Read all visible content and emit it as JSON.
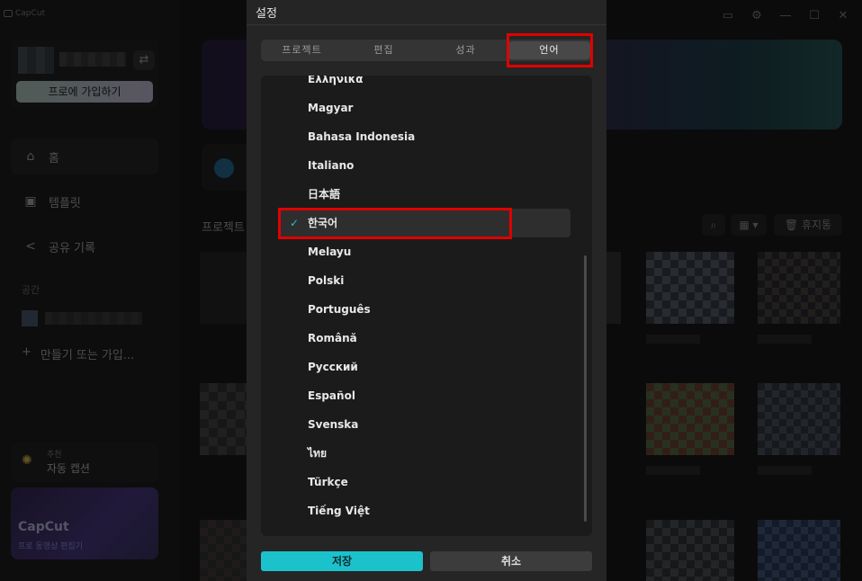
{
  "app": {
    "logo": "CapCut"
  },
  "sidebar": {
    "pro_button": "프로에 가입하기",
    "nav": [
      {
        "label": "홈",
        "icon": "home-icon"
      },
      {
        "label": "템플릿",
        "icon": "template-icon"
      },
      {
        "label": "공유 기록",
        "icon": "share-icon"
      }
    ],
    "space_label": "공간",
    "create_label": "만들기 또는 가입...",
    "caption_card": {
      "sub": "추천",
      "title": "자동 캡션"
    },
    "promo": {
      "title": "CapCut",
      "subtitle": "프로 동영상 편집기"
    }
  },
  "main": {
    "projects_title": "프로젝트",
    "trash_label": "휴지통"
  },
  "dialog": {
    "title": "설정",
    "tabs": [
      "프로젝트",
      "편집",
      "성과",
      "언어"
    ],
    "active_tab": 3,
    "languages": [
      "Ελληνικά",
      "Magyar",
      "Bahasa Indonesia",
      "Italiano",
      "日本語",
      "한국어",
      "Melayu",
      "Polski",
      "Português",
      "Română",
      "Русский",
      "Español",
      "Svenska",
      "ไทย",
      "Türkçe",
      "Tiếng Việt"
    ],
    "selected_language": "한국어",
    "check_glyph": "✓",
    "save_label": "저장",
    "cancel_label": "취소"
  },
  "colors": {
    "accent": "#1bc2cc",
    "highlight": "#e00000"
  }
}
